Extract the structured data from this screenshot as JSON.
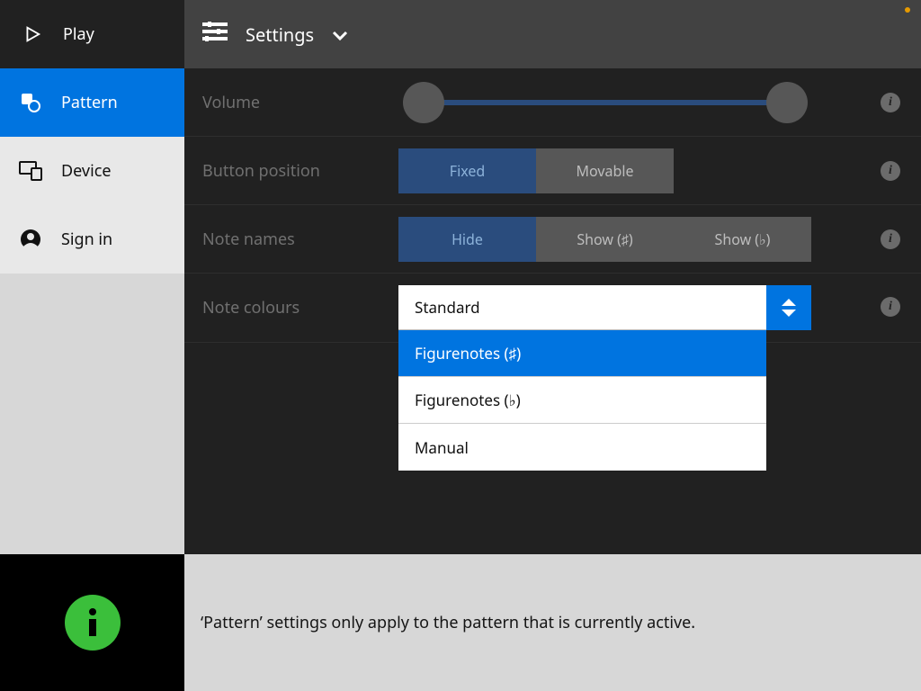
{
  "top": {
    "play_label": "Play",
    "settings_label": "Settings"
  },
  "sidebar": {
    "items": [
      {
        "label": "Pattern"
      },
      {
        "label": "Device"
      },
      {
        "label": "Sign in"
      }
    ]
  },
  "settings": {
    "volume": {
      "label": "Volume"
    },
    "button_position": {
      "label": "Button position",
      "options": [
        "Fixed",
        "Movable"
      ],
      "selected": "Fixed"
    },
    "note_names": {
      "label": "Note names",
      "options": [
        "Hide",
        "Show (♯)",
        "Show (♭)"
      ],
      "selected": "Hide"
    },
    "note_colours": {
      "label": "Note colours",
      "selected": "Standard",
      "options": [
        "Standard",
        "Figurenotes (♯)",
        "Figurenotes (♭)",
        "Manual"
      ],
      "highlighted": "Figurenotes (♯)"
    }
  },
  "footer": {
    "message": "‘Pattern’ settings only apply to the pattern that is currently active."
  },
  "icons": {
    "info_glyph": "i"
  }
}
